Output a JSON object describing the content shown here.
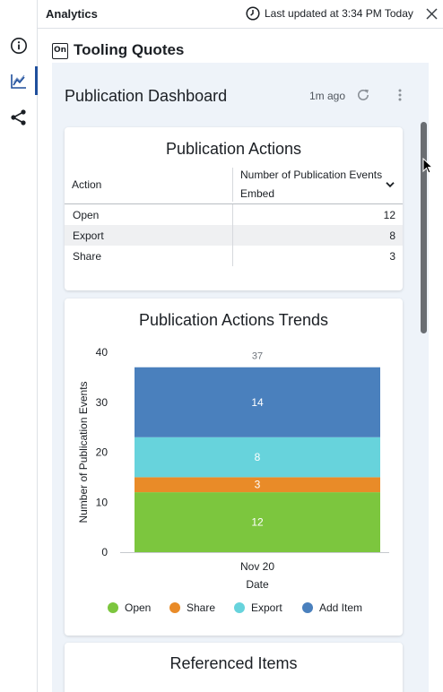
{
  "header": {
    "title": "Analytics",
    "last_updated": "Last updated at 3:34 PM Today"
  },
  "rail": {
    "items": [
      {
        "icon": "info-icon"
      },
      {
        "icon": "line-chart-icon",
        "active": true
      },
      {
        "icon": "share-icon"
      }
    ]
  },
  "document": {
    "title": "Tooling Quotes",
    "icon_label": "On"
  },
  "dashboard": {
    "title": "Publication Dashboard",
    "updated_ago": "1m ago"
  },
  "actions_table": {
    "title": "Publication Actions",
    "col_action": "Action",
    "col_metric": "Number of Publication Events",
    "col_metric_sub": "Embed",
    "rows": [
      {
        "action": "Open",
        "value": "12"
      },
      {
        "action": "Export",
        "value": "8"
      },
      {
        "action": "Share",
        "value": "3"
      }
    ]
  },
  "trends": {
    "title": "Publication Actions Trends"
  },
  "chart_data": {
    "type": "bar",
    "stacked": true,
    "title": "Publication Actions Trends",
    "xlabel": "Date",
    "ylabel": "Number of Publication Events",
    "categories": [
      "Nov 20"
    ],
    "ylim": [
      0,
      40
    ],
    "yticks": [
      0,
      10,
      20,
      30,
      40
    ],
    "total_label": "37",
    "series": [
      {
        "name": "Open",
        "values": [
          12
        ],
        "color": "#7cc63e"
      },
      {
        "name": "Share",
        "values": [
          3
        ],
        "color": "#e98b28"
      },
      {
        "name": "Export",
        "values": [
          8
        ],
        "color": "#67d3dc"
      },
      {
        "name": "Add Item",
        "values": [
          14
        ],
        "color": "#4a80bd"
      }
    ],
    "legend_position": "bottom"
  },
  "referenced": {
    "title": "Referenced Items"
  }
}
